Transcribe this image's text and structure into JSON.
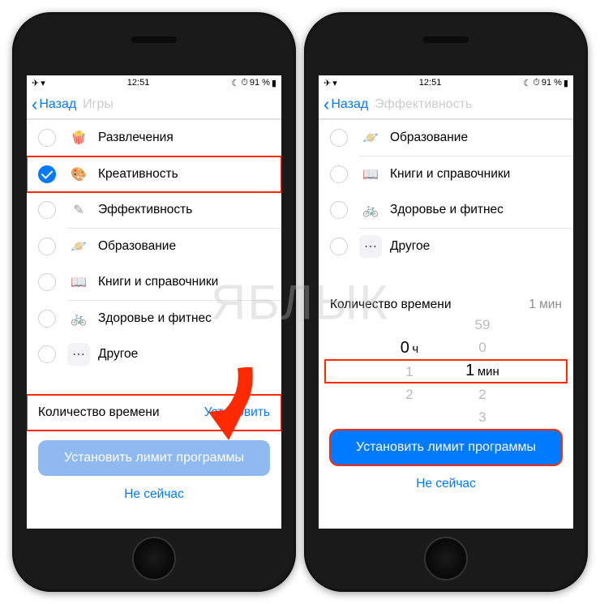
{
  "watermark": "ЯБЛЫК",
  "status": {
    "time": "12:51",
    "battery": "91 %"
  },
  "nav": {
    "back": "Назад",
    "title_ghost_left": "Игры",
    "title_ghost_right": "Эффективность"
  },
  "categories_left": [
    {
      "label": "Развлечения"
    },
    {
      "label": "Креативность"
    },
    {
      "label": "Эффективность"
    },
    {
      "label": "Образование"
    },
    {
      "label": "Книги и справочники"
    },
    {
      "label": "Здоровье и фитнес"
    },
    {
      "label": "Другое"
    }
  ],
  "categories_right": [
    {
      "label": "Образование"
    },
    {
      "label": "Книги и справочники"
    },
    {
      "label": "Здоровье и фитнес"
    },
    {
      "label": "Другое"
    }
  ],
  "time_section": {
    "label": "Количество времени",
    "set_action": "Установить",
    "value_short": "1 мин"
  },
  "picker": {
    "hours": {
      "prev2": "",
      "prev": "",
      "current": "0",
      "next": "1",
      "next2": "2",
      "unit": "ч"
    },
    "mins": {
      "prev2": "59",
      "prev": "0",
      "current": "1",
      "next": "2",
      "next2": "3",
      "unit": "мин"
    }
  },
  "buttons": {
    "primary": "Установить лимит программы",
    "secondary": "Не сейчас"
  }
}
